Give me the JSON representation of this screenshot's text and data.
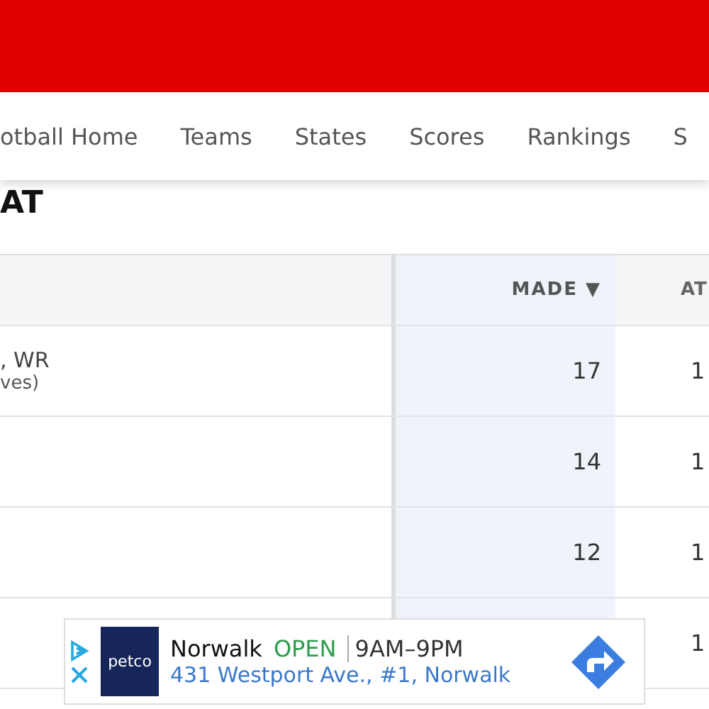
{
  "nav": {
    "items": [
      {
        "label": "otball Home",
        "selected": false
      },
      {
        "label": "Teams",
        "selected": false
      },
      {
        "label": "States",
        "selected": false
      },
      {
        "label": "Scores",
        "selected": false
      },
      {
        "label": "Rankings",
        "selected": false
      },
      {
        "label": "S",
        "selected": false
      }
    ]
  },
  "page_title": "AT",
  "table": {
    "columns": [
      {
        "label": "MADE ▼",
        "sorted": true
      },
      {
        "label": "AT",
        "sorted": false
      }
    ],
    "rows": [
      {
        "name": ", WR",
        "sub": "ves)",
        "made": "17",
        "att": "1"
      },
      {
        "made": "14",
        "att": "1"
      },
      {
        "made": "12",
        "att": "1"
      },
      {
        "att": "1"
      }
    ]
  },
  "ad": {
    "brand": "petco",
    "store": "Norwalk",
    "status": "OPEN",
    "hours": "9AM–9PM",
    "address": "431 Westport Ave., #1, Norwalk"
  }
}
